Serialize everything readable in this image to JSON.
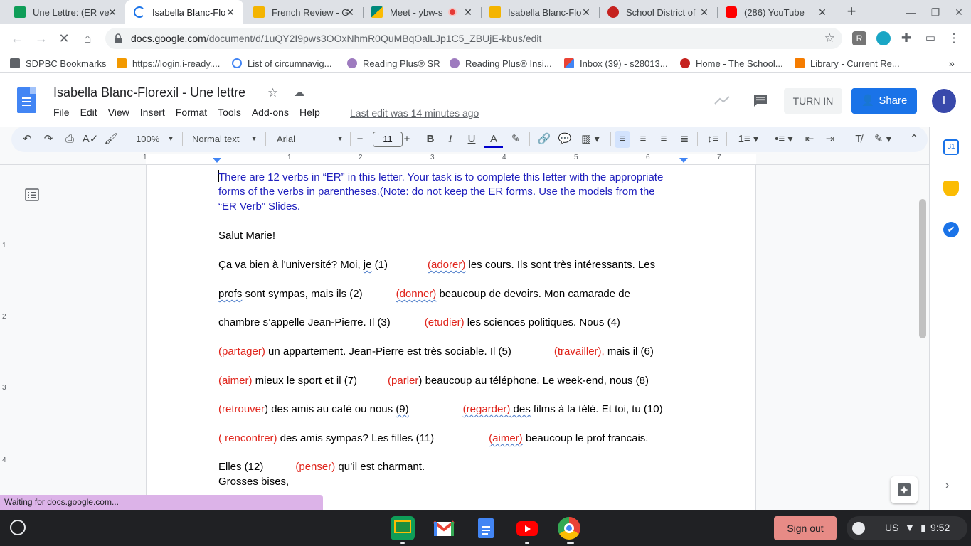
{
  "browser": {
    "tabs": [
      {
        "title": "Une Lettre: (ER ve",
        "favicon_color": "#0f9d58",
        "active": false
      },
      {
        "title": "Isabella Blanc-Flo",
        "favicon_color": "#1a73e8",
        "active": true
      },
      {
        "title": "French Review - G",
        "favicon_color": "#f4b400",
        "active": false
      },
      {
        "title": "Meet - ybw-s",
        "favicon_color": "#00897b",
        "active": false
      },
      {
        "title": "Isabella Blanc-Flo",
        "favicon_color": "#f4b400",
        "active": false
      },
      {
        "title": "School District of",
        "favicon_color": "#c5221f",
        "active": false
      },
      {
        "title": "(286) YouTube",
        "favicon_color": "#ff0000",
        "active": false
      }
    ],
    "url_host": "docs.google.com",
    "url_path": "/document/d/1uQY2I9pws3OOxNhmR0QuMBqOalLJp1C5_ZBUjE-kbus/edit",
    "bookmarks": [
      {
        "label": "SDPBC Bookmarks",
        "icon": "folder-icon"
      },
      {
        "label": "https://login.i-ready....",
        "icon": "iready-icon"
      },
      {
        "label": "List of circumnavig...",
        "icon": "google-icon"
      },
      {
        "label": "Reading Plus® SR",
        "icon": "readingplus-icon"
      },
      {
        "label": "Reading Plus® Insi...",
        "icon": "readingplus-icon"
      },
      {
        "label": "Inbox (39) - s28013...",
        "icon": "gmail-icon"
      },
      {
        "label": "Home - The School...",
        "icon": "school-icon"
      },
      {
        "label": "Library - Current Re...",
        "icon": "library-icon"
      }
    ]
  },
  "docs": {
    "title": "Isabella Blanc-Florexil - Une lettre",
    "menu": [
      "File",
      "Edit",
      "View",
      "Insert",
      "Format",
      "Tools",
      "Add-ons",
      "Help"
    ],
    "last_edit": "Last edit was 14 minutes ago",
    "turn_in": "TURN IN",
    "share": "Share",
    "avatar_letter": "I",
    "toolbar": {
      "zoom": "100%",
      "style": "Normal text",
      "font": "Arial",
      "font_size": "11"
    },
    "ruler_numbers": [
      "1",
      "1",
      "2",
      "3",
      "4",
      "5",
      "6",
      "7"
    ],
    "vruler_numbers": [
      "1",
      "2",
      "3",
      "4"
    ]
  },
  "document": {
    "instructions": [
      "There are 12 verbs in “ER” in this letter. Your task is to complete this letter with the appropriate",
      "forms of the verbs in parentheses.(Note: do not keep the ER forms. Use the models from the",
      "“ER Verb” Slides."
    ],
    "greeting": "Salut Marie!",
    "lines": [
      [
        "Ça va bien à l'université? Moi, ",
        "je",
        " (1)",
        "(adorer)",
        " les cours. Ils sont très intéressants. Les"
      ],
      [
        "profs",
        " sont sympas, mais ils (2)",
        "(donner)",
        " beaucoup de devoirs. Mon camarade de"
      ],
      [
        "chambre s’appelle Jean-Pierre. Il (3)",
        "(etudier)",
        " les sciences politiques. Nous (4)"
      ],
      [
        "(partager)",
        " un appartement. Jean-Pierre est très sociable. Il (5)",
        "(travailler),",
        " mais il (6)"
      ],
      [
        "(aimer)",
        " mieux le sport et il (7)",
        "(parler",
        ") beaucoup au téléphone.  Le week-end, nous (8)"
      ],
      [
        "(retrouver",
        ") des amis au café ou nous ",
        "(9)",
        "(regarder)",
        " des",
        " films à la télé. Et toi, tu (10)"
      ],
      [
        "( rencontrer)",
        " des amis sympas? Les filles (11)",
        "(aimer)",
        " beaucoup le prof francais."
      ],
      [
        "Elles (12)",
        "(penser)",
        " qu’il est charmant."
      ],
      [
        "Grosses bises,"
      ]
    ]
  },
  "status": "Waiting for docs.google.com...",
  "shelf": {
    "sign_out": "Sign out",
    "locale": "US",
    "time": "9:52"
  }
}
